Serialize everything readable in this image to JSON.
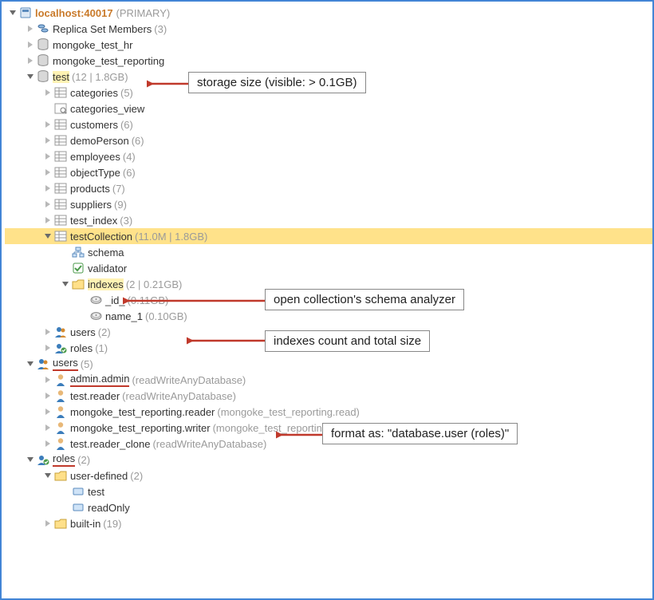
{
  "server": {
    "label": "localhost:40017",
    "suffix": "(PRIMARY)"
  },
  "replica": {
    "label": "Replica Set Members",
    "meta": "(3)"
  },
  "dbs": {
    "hr": "mongoke_test_hr",
    "reporting": "mongoke_test_reporting",
    "test": {
      "label": "test",
      "meta": "(12 | 1.8GB)"
    }
  },
  "test_collections": [
    {
      "name": "categories",
      "meta": "(5)"
    },
    {
      "name": "categories_view",
      "meta": "",
      "view": true
    },
    {
      "name": "customers",
      "meta": "(6)"
    },
    {
      "name": "demoPerson",
      "meta": "(6)"
    },
    {
      "name": "employees",
      "meta": "(4)"
    },
    {
      "name": "objectType",
      "meta": "(6)"
    },
    {
      "name": "products",
      "meta": "(7)"
    },
    {
      "name": "suppliers",
      "meta": "(9)"
    },
    {
      "name": "test_index",
      "meta": "(3)"
    }
  ],
  "testCollection": {
    "label": "testCollection",
    "meta": "(11.0M | 1.8GB)"
  },
  "schema": "schema",
  "validator": "validator",
  "indexes": {
    "label": "indexes",
    "meta": "(2 | 0.21GB)"
  },
  "index_items": [
    {
      "name": "_id_",
      "meta": "(0.11GB)"
    },
    {
      "name": "name_1",
      "meta": "(0.10GB)"
    }
  ],
  "db_users": {
    "label": "users",
    "meta": "(2)"
  },
  "db_roles": {
    "label": "roles",
    "meta": "(1)"
  },
  "global_users": {
    "label": "users",
    "meta": "(5)"
  },
  "user_list": [
    {
      "name": "admin.admin",
      "roles": "(readWriteAnyDatabase)"
    },
    {
      "name": "test.reader",
      "roles": "(readWriteAnyDatabase)"
    },
    {
      "name": "mongoke_test_reporting.reader",
      "roles": "(mongoke_test_reporting.read)"
    },
    {
      "name": "mongoke_test_reporting.writer",
      "roles": "(mongoke_test_reporting.readWrite)"
    },
    {
      "name": "test.reader_clone",
      "roles": "(readWriteAnyDatabase)"
    }
  ],
  "global_roles": {
    "label": "roles",
    "meta": "(2)"
  },
  "user_defined": {
    "label": "user-defined",
    "meta": "(2)"
  },
  "role_items": [
    "test",
    "readOnly"
  ],
  "builtin": {
    "label": "built-in",
    "meta": "(19)"
  },
  "callouts": {
    "storage": "storage size (visible: > 0.1GB)",
    "schema": "open collection's schema analyzer",
    "indexes": "indexes count and total size",
    "format": "format as: \"database.user (roles)\""
  }
}
